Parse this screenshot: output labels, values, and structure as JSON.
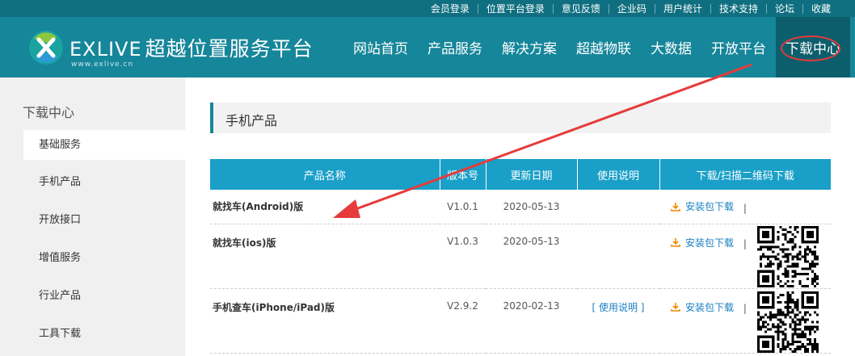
{
  "top_links": [
    "会员登录",
    "位置平台登录",
    "意见反馈",
    "企业码",
    "用户统计",
    "技术支持",
    "论坛",
    "收藏"
  ],
  "brand": {
    "name_en": "EXLIVE",
    "name_cn": "超越位置服务平台",
    "url": "www.exlive.cn"
  },
  "nav": [
    "网站首页",
    "产品服务",
    "解决方案",
    "超越物联",
    "大数据",
    "开放平台",
    "下载中心"
  ],
  "nav_active_index": 6,
  "sidebar": {
    "title": "下载中心",
    "items": [
      "基础服务",
      "手机产品",
      "开放接口",
      "增值服务",
      "行业产品",
      "工具下载"
    ],
    "active_index": 0
  },
  "section_title": "手机产品",
  "table": {
    "headers": [
      "产品名称",
      "版本号",
      "更新日期",
      "使用说明",
      "下载/扫描二维码下载"
    ],
    "rows": [
      {
        "name": "就找车(Android)版",
        "version": "V1.0.1",
        "date": "2020-05-13",
        "doc": "",
        "download": "安装包下载",
        "sep": "|"
      },
      {
        "name": "就找车(ios)版",
        "version": "V1.0.3",
        "date": "2020-05-13",
        "doc": "",
        "download": "安装包下载",
        "sep": "|"
      },
      {
        "name": "手机查车(iPhone/iPad)版",
        "version": "V2.9.2",
        "date": "2020-02-13",
        "doc": "[ 使用说明 ]",
        "download": "安装包下载",
        "sep": "|"
      }
    ]
  },
  "colors": {
    "header": "#16869a",
    "topbar": "#0f6f80",
    "table_head": "#1aa0c8",
    "link": "#1a7fc0",
    "annotation": "#e53b3b"
  },
  "icons": {
    "download": "download-icon",
    "qr": "qr-code-icon"
  }
}
